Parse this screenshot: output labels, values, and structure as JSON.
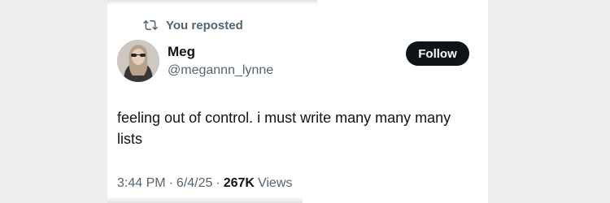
{
  "repost": {
    "label": "You reposted",
    "icon": "repost-icon"
  },
  "author": {
    "name": "Meg",
    "handle": "@megannn_lynne",
    "avatar_icon": "avatar"
  },
  "follow_button": {
    "label": "Follow"
  },
  "tweet": {
    "text": "feeling out of control. i must write many many many lists"
  },
  "meta": {
    "time": "3:44 PM",
    "separator": "·",
    "date": "6/4/25",
    "views_count": "267K",
    "views_label": "Views"
  },
  "colors": {
    "text_primary": "#0f1419",
    "text_secondary": "#536471",
    "button_bg": "#0f1419",
    "button_text": "#ffffff"
  }
}
